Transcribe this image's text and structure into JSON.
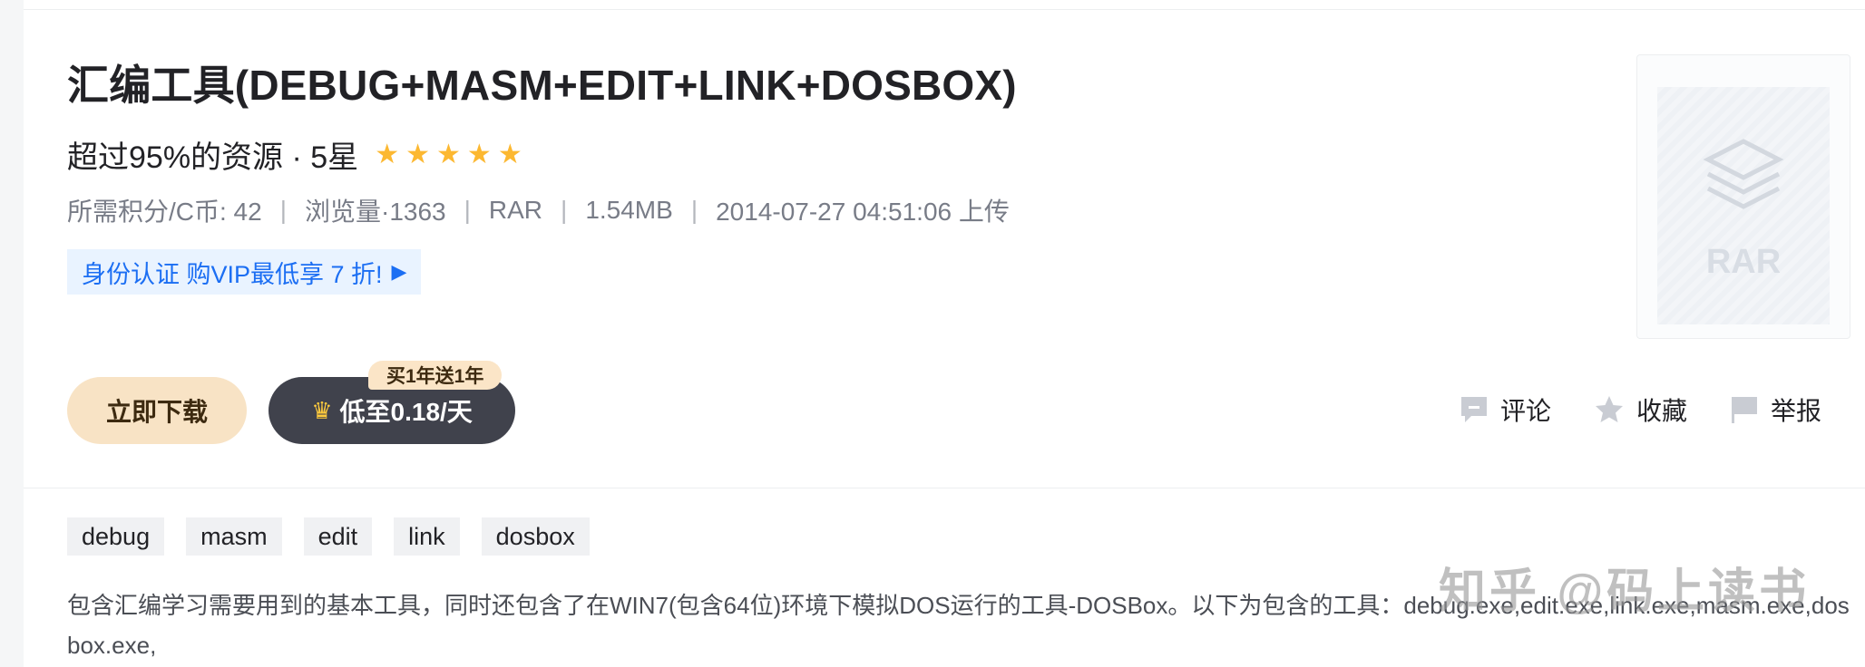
{
  "resource": {
    "title": "汇编工具(DEBUG+MASM+EDIT+LINK+DOSBOX)",
    "rating_text": "超过95%的资源 · 5星",
    "stars": [
      "★",
      "★",
      "★",
      "★",
      "★"
    ]
  },
  "meta": {
    "credits": "所需积分/C币: 42",
    "views": "浏览量·1363",
    "format": "RAR",
    "size": "1.54MB",
    "uploaded": "2014-07-27 04:51:06 上传",
    "separator": "|"
  },
  "promo": {
    "label": "身份认证 购VIP最低享 7 折!",
    "arrow": "▶"
  },
  "buttons": {
    "download": "立即下载",
    "vip_crown": "♛",
    "vip": "低至0.18/天",
    "vip_badge": "买1年送1年"
  },
  "actions": {
    "comment": "评论",
    "favorite": "收藏",
    "report": "举报"
  },
  "thumbnail": {
    "label": "RAR"
  },
  "tags": [
    "debug",
    "masm",
    "edit",
    "link",
    "dosbox"
  ],
  "description": "包含汇编学习需要用到的基本工具，同时还包含了在WIN7(包含64位)环境下模拟DOS运行的工具-DOSBox。以下为包含的工具：debug.exe,edit.exe,link.exe,masm.exe,dosbox.exe,",
  "watermark": "知乎 @码上读书",
  "colors": {
    "star": "#fcb831",
    "promo_text": "#1b6ef3",
    "download_bg": "#f8e3c5",
    "vip_bg": "#40424c"
  }
}
